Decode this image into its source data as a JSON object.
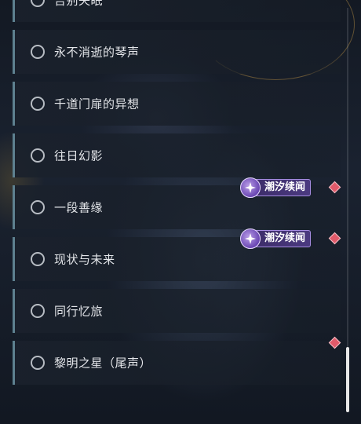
{
  "quests": [
    {
      "label": "告别失眠",
      "badge": "",
      "marker": false
    },
    {
      "label": "永不消逝的琴声",
      "badge": "",
      "marker": false
    },
    {
      "label": "千道门扉的异想",
      "badge": "",
      "marker": false
    },
    {
      "label": "往日幻影",
      "badge": "",
      "marker": false
    },
    {
      "label": "一段善缘",
      "badge": "潮汐续闻",
      "marker": true
    },
    {
      "label": "现状与未来",
      "badge": "潮汐续闻",
      "marker": true
    },
    {
      "label": "同行忆旅",
      "badge": "",
      "marker": false
    },
    {
      "label": "黎明之星（尾声）",
      "badge": "",
      "marker": true
    }
  ],
  "scroll": {
    "thumb_fraction": 0.16,
    "position_fraction": 1.0
  },
  "colors": {
    "accent_bar": "#5e8190",
    "badge_purple": "#4b3a80",
    "marker_red": "#e05a6a"
  },
  "icons": {
    "status": "circle-outline-icon",
    "badge": "sparkle-star-icon",
    "marker": "red-diamond-icon"
  }
}
